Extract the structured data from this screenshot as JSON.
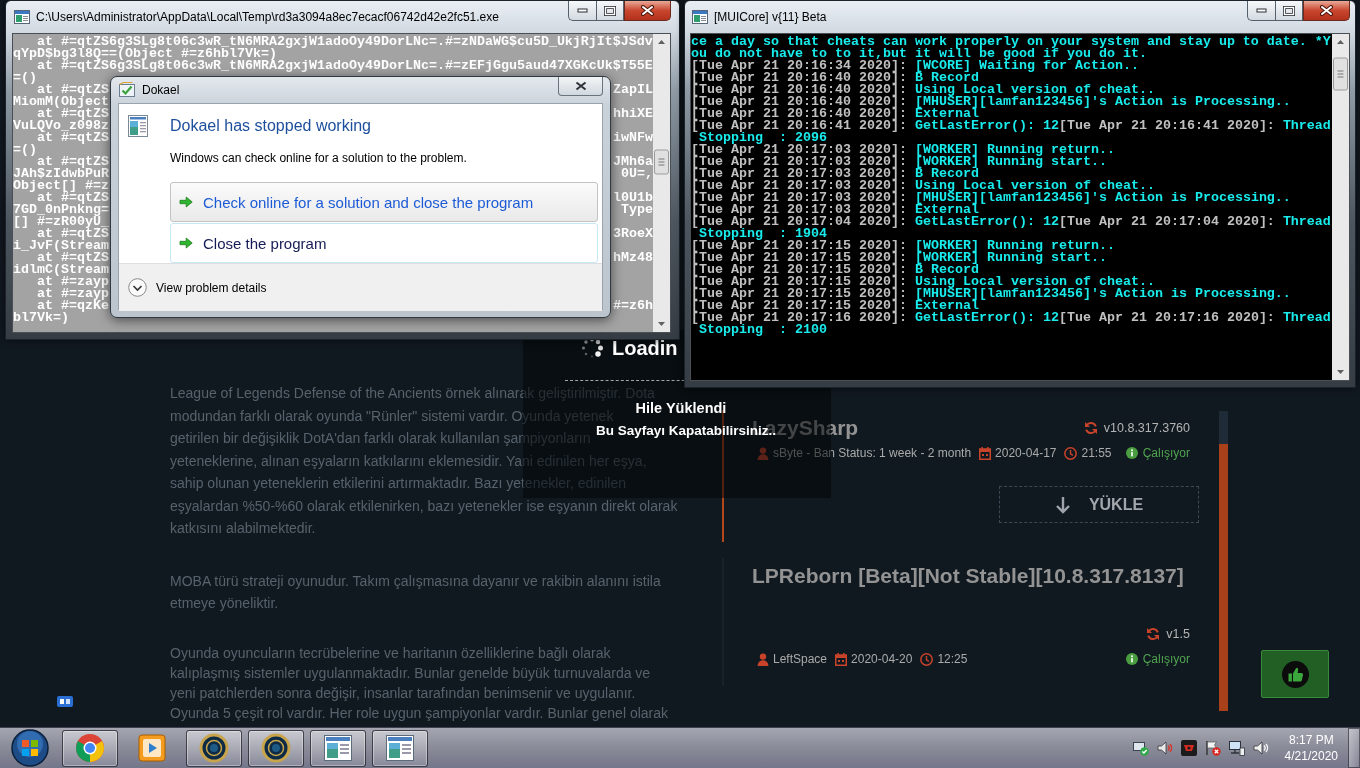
{
  "error_console": {
    "title": "C:\\Users\\Administrator\\AppData\\Local\\Temp\\rd3a3094a8ec7ecacf06742d42e2fc51.exe",
    "lines": [
      {
        "parts": [
          "   at #=qtZS6g3SLg8t06c3wR_tN6MRA2gxjW1adoOy49DorLNc=.#=zNDaWG$cu5D_UkjRjIt$JSdv"
        ]
      },
      {
        "parts": [
          "qYpD$bg3l8Q==(Object #=z6hbl7Vk=)"
        ]
      },
      {
        "parts": [
          "   at #=qtZS6g3SLg8t06c3wR_tN6MRA2gxjW1adoOy49DorLNc=.#=zEFjGgu5aud47XGKcUk$T55E"
        ]
      },
      {
        "parts": [
          "=()"
        ]
      },
      {
        "parts": [
          "   at #=qtZS",
          "ZapIL"
        ]
      },
      {
        "parts": [
          "MiomM(Object"
        ]
      },
      {
        "parts": [
          "   at #=qtZS",
          "hhiXE"
        ]
      },
      {
        "parts": [
          "VuLQVo_z098z"
        ]
      },
      {
        "parts": [
          "   at #=qtZS",
          "iwNFw"
        ]
      },
      {
        "parts": [
          "=()"
        ]
      },
      {
        "parts": [
          "   at #=qtZS",
          "JMh6a"
        ]
      },
      {
        "parts": [
          "JAh$zIdwbPuR",
          "0U=,"
        ]
      },
      {
        "parts": [
          "Object[] #=z"
        ]
      },
      {
        "parts": [
          "   at #=qtZS",
          "l0U1b"
        ]
      },
      {
        "parts": [
          "7GD_0nPnkng=",
          "Type"
        ]
      },
      {
        "parts": [
          "[] #=zR00yU_"
        ]
      },
      {
        "parts": [
          "   at #=qtZS",
          "3RoeX"
        ]
      },
      {
        "parts": [
          "i_JvF(Stream"
        ]
      },
      {
        "parts": [
          "   at #=qtZS",
          "hMz48"
        ]
      },
      {
        "parts": [
          "idlmC(Stream"
        ]
      },
      {
        "parts": [
          "   at #=zayp"
        ]
      },
      {
        "parts": [
          "   at #=zayp"
        ]
      },
      {
        "parts": [
          "   at #=qzKe",
          "#=z6h"
        ]
      },
      {
        "parts": [
          "bl7Vk=)"
        ]
      }
    ]
  },
  "crash_dialog": {
    "title": "Dokael",
    "heading": "Dokael has stopped working",
    "message": "Windows can check online for a solution to the problem.",
    "options": [
      {
        "label": "Check online for a solution and close the program",
        "highlighted": true
      },
      {
        "label": "Close the program",
        "highlighted": false
      }
    ],
    "details": "View problem details"
  },
  "log_console": {
    "title": "[MUICore] v{11} Beta",
    "lines": [
      {
        "segments": [
          {
            "kind": "message",
            "text": "ce a day so that cheats can work properly on your system and stay up to date. *Y"
          }
        ]
      },
      {
        "segments": [
          {
            "kind": "message",
            "text": "ou do not have to to it,but it will be good if you do it."
          }
        ]
      },
      {
        "segments": [
          {
            "kind": "time",
            "text": "[Tue Apr 21 20:16:34 2020]:"
          },
          {
            "kind": "message",
            "text": "[WCORE] Waiting for Action.."
          }
        ]
      },
      {
        "segments": [
          {
            "kind": "time",
            "text": "[Tue Apr 21 20:16:40 2020]:"
          },
          {
            "kind": "message",
            "text": "B Record"
          }
        ]
      },
      {
        "segments": [
          {
            "kind": "time",
            "text": "[Tue Apr 21 20:16:40 2020]:"
          },
          {
            "kind": "message",
            "text": "Using Local version of cheat.."
          }
        ]
      },
      {
        "segments": [
          {
            "kind": "time",
            "text": "[Tue Apr 21 20:16:40 2020]:"
          },
          {
            "kind": "message",
            "text": "[MHUSER][lamfan123456]'s Action is Processing.."
          }
        ]
      },
      {
        "segments": [
          {
            "kind": "time",
            "text": "[Tue Apr 21 20:16:40 2020]:"
          },
          {
            "kind": "message",
            "text": "External"
          }
        ]
      },
      {
        "segments": [
          {
            "kind": "time",
            "text": "[Tue Apr 21 20:16:41 2020]:"
          },
          {
            "kind": "message",
            "text": "GetLastError(): 12"
          },
          {
            "kind": "time",
            "text": "[Tue Apr 21 20:16:41 2020]:"
          },
          {
            "kind": "message",
            "text": "Thread"
          }
        ]
      },
      {
        "segments": [
          {
            "kind": "message",
            "text": " Stopping  : 2096"
          }
        ]
      },
      {
        "segments": [
          {
            "kind": "time",
            "text": "[Tue Apr 21 20:17:03 2020]:"
          },
          {
            "kind": "message",
            "text": "[WORKER] Running return.."
          }
        ]
      },
      {
        "segments": [
          {
            "kind": "time",
            "text": "[Tue Apr 21 20:17:03 2020]:"
          },
          {
            "kind": "message",
            "text": "[WORKER] Running start.."
          }
        ]
      },
      {
        "segments": [
          {
            "kind": "time",
            "text": "[Tue Apr 21 20:17:03 2020]:"
          },
          {
            "kind": "message",
            "text": "B Record"
          }
        ]
      },
      {
        "segments": [
          {
            "kind": "time",
            "text": "[Tue Apr 21 20:17:03 2020]:"
          },
          {
            "kind": "message",
            "text": "Using Local version of cheat.."
          }
        ]
      },
      {
        "segments": [
          {
            "kind": "time",
            "text": "[Tue Apr 21 20:17:03 2020]:"
          },
          {
            "kind": "message",
            "text": "[MHUSER][lamfan123456]'s Action is Processing.."
          }
        ]
      },
      {
        "segments": [
          {
            "kind": "time",
            "text": "[Tue Apr 21 20:17:03 2020]:"
          },
          {
            "kind": "message",
            "text": "External"
          }
        ]
      },
      {
        "segments": [
          {
            "kind": "time",
            "text": "[Tue Apr 21 20:17:04 2020]:"
          },
          {
            "kind": "message",
            "text": "GetLastError(): 12"
          },
          {
            "kind": "time",
            "text": "[Tue Apr 21 20:17:04 2020]:"
          },
          {
            "kind": "message",
            "text": "Thread"
          }
        ]
      },
      {
        "segments": [
          {
            "kind": "message",
            "text": " Stopping  : 1904"
          }
        ]
      },
      {
        "segments": [
          {
            "kind": "time",
            "text": "[Tue Apr 21 20:17:15 2020]:"
          },
          {
            "kind": "message",
            "text": "[WORKER] Running return.."
          }
        ]
      },
      {
        "segments": [
          {
            "kind": "time",
            "text": "[Tue Apr 21 20:17:15 2020]:"
          },
          {
            "kind": "message",
            "text": "[WORKER] Running start.."
          }
        ]
      },
      {
        "segments": [
          {
            "kind": "time",
            "text": "[Tue Apr 21 20:17:15 2020]:"
          },
          {
            "kind": "message",
            "text": "B Record"
          }
        ]
      },
      {
        "segments": [
          {
            "kind": "time",
            "text": "[Tue Apr 21 20:17:15 2020]:"
          },
          {
            "kind": "message",
            "text": "Using Local version of cheat.."
          }
        ]
      },
      {
        "segments": [
          {
            "kind": "time",
            "text": "[Tue Apr 21 20:17:15 2020]:"
          },
          {
            "kind": "message",
            "text": "[MHUSER][lamfan123456]'s Action is Processing.."
          }
        ]
      },
      {
        "segments": [
          {
            "kind": "time",
            "text": "[Tue Apr 21 20:17:15 2020]:"
          },
          {
            "kind": "message",
            "text": "External"
          }
        ]
      },
      {
        "segments": [
          {
            "kind": "time",
            "text": "[Tue Apr 21 20:17:16 2020]:"
          },
          {
            "kind": "message",
            "text": "GetLastError(): 12"
          },
          {
            "kind": "time",
            "text": "[Tue Apr 21 20:17:16 2020]:"
          },
          {
            "kind": "message",
            "text": "Thread"
          }
        ]
      },
      {
        "segments": [
          {
            "kind": "message",
            "text": " Stopping  : 2100"
          }
        ]
      }
    ]
  },
  "web_page": {
    "loading_overlay": {
      "title": "Loadin",
      "message": "Hile Yüklendi",
      "hint": "Bu Sayfayı Kapatabilirsiniz.."
    },
    "article": {
      "paragraphs": [
        {
          "lines": [
            "League of Legends Defense of the Ancients örnek alınarak geliştirilmiştir. Dota",
            "modundan farklı olarak oyunda \"Rünler\" sistemi vardır. Oyunda yetenek",
            "getirilen bir değişiklik DotA'dan farklı olarak kullanılan şampiyonların",
            "yeteneklerine, alınan eşyaların katkılarını eklemesidir. Yani edinilen her eşya,",
            "sahip olunan yeteneklerin etkilerini artırmaktadır. Bazı yetenekler, edinilen",
            "eşyalardan %50-%60 olarak etkilenirken, bazı yetenekler ise eşyanın direkt olarak",
            "katkısını alabilmektedir."
          ]
        },
        {
          "lines": [
            "MOBA türü strateji oyunudur. Takım çalışmasına dayanır ve rakibin alanını istila",
            "etmeye yöneliktir."
          ]
        },
        {
          "lines": [
            "Oyunda oyuncuların tecrübelerine ve haritanın özelliklerine bağlı olarak",
            "kalıplaşmış sistemler uygulanmaktadır. Bunlar genelde büyük turnuvalarda ve",
            "yeni patchlerden sonra değişir, insanlar tarafından benimsenir ve uygulanır.",
            "Oyunda 5 çeşit rol vardır. Her role uygun şampiyonlar vardır. Bunlar genel olarak"
          ]
        }
      ]
    },
    "releases": [
      {
        "title": "LazySharp",
        "version": "v10.8.317.3760",
        "author": "sByte - Ban Status: 1 week - 2 month",
        "date": "2020-04-17",
        "time": "21:55",
        "status": "Çalışıyor",
        "selected": true,
        "download_button": "YÜKLE"
      },
      {
        "title": "LPReborn [Beta][Not Stable][10.8.317.8137]",
        "version": "v1.5",
        "author": "LeftSpace",
        "date": "2020-04-20",
        "time": "12:25",
        "status": "Çalışıyor",
        "selected": false
      }
    ]
  },
  "taskbar": {
    "buttons": [
      {
        "kind": "browser",
        "running": true
      },
      {
        "kind": "media",
        "running": false
      },
      {
        "kind": "game",
        "running": true
      },
      {
        "kind": "game",
        "running": true
      },
      {
        "kind": "console",
        "running": true
      },
      {
        "kind": "console",
        "running": true
      }
    ],
    "clock": {
      "time": "8:17 PM",
      "date": "4/21/2020"
    }
  }
}
